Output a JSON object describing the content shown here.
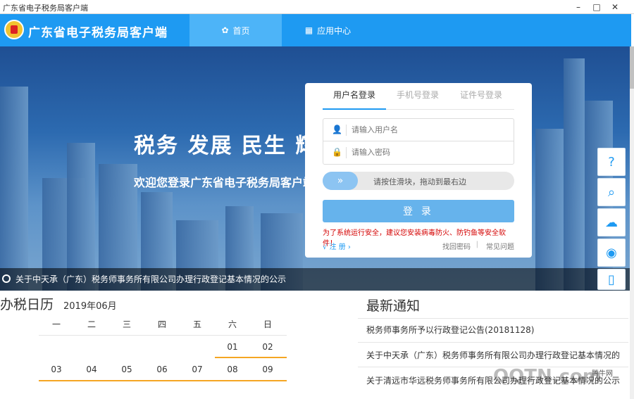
{
  "window": {
    "title": "广东省电子税务局客户端",
    "minimize": "–",
    "maximize": "□",
    "close": "✕"
  },
  "nav": {
    "app_title": "广东省电子税务局客户端",
    "tabs": [
      {
        "label": "首页",
        "icon": "home-icon"
      },
      {
        "label": "应用中心",
        "icon": "grid-icon"
      }
    ],
    "active_color": "#4db4f8",
    "bar_color": "#1e9af2"
  },
  "hero": {
    "slogan": "税务 发展 民生 辉煌",
    "welcome": "欢迎您登录广东省电子税务局客户端",
    "ticker": "关于中天承（广东）税务师事务所有限公司办理行政登记基本情况的公示"
  },
  "login": {
    "tabs": [
      "用户名登录",
      "手机号登录",
      "证件号登录"
    ],
    "username_placeholder": "请输入用户名",
    "password_placeholder": "请输入密码",
    "slider_text": "请按住滑块，拖动到最右边",
    "slider_knob": "»",
    "login_button": "登 录",
    "warning": "为了系统运行安全，建议您安装病毒防火、防钓鱼等安全软件！",
    "register": "√ 注 册 ›",
    "forgot": "找回密码",
    "separator": "|",
    "faq": "常见问题"
  },
  "calendar": {
    "title": "办税日历",
    "month": "2019年06月",
    "weekdays": [
      "一",
      "二",
      "三",
      "四",
      "五",
      "六",
      "日"
    ],
    "row1": [
      "01",
      "02"
    ],
    "row2": [
      "03",
      "04",
      "05",
      "06",
      "07",
      "08",
      "09"
    ]
  },
  "news": {
    "title": "最新通知",
    "items": [
      "税务师事务所予以行政登记公告(20181128)",
      "关于中天承（广东）税务师事务所有限公司办理行政登记基本情况的",
      "关于清远市华远税务师事务所有限公司办理行政登记基本情况的公示"
    ]
  },
  "side_icons": [
    "help-icon",
    "search-icon",
    "wechat-icon",
    "weibo-icon",
    "mobile-icon"
  ],
  "watermark": {
    "text": "QQTN.com",
    "small": "腾牛网"
  }
}
